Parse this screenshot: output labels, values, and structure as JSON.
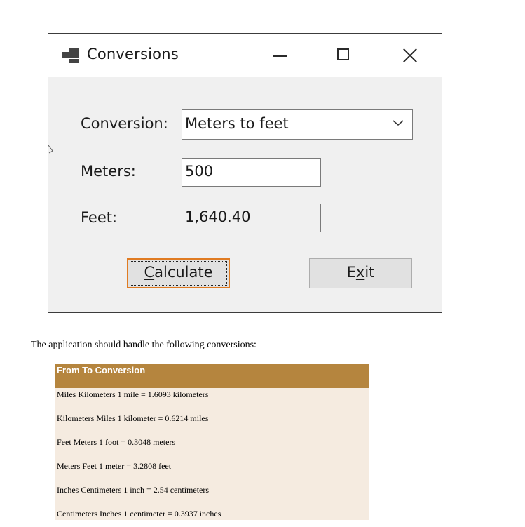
{
  "window": {
    "title": "Conversions",
    "app_icon": "app-window-icon",
    "controls": {
      "minimize_icon": "minimize-icon",
      "maximize_icon": "maximize-icon",
      "close_icon": "close-icon"
    }
  },
  "form": {
    "conversion_label": "Conversion:",
    "conversion_value": "Meters to feet",
    "conversion_arrow_icon": "chevron-down-icon",
    "meters_label": "Meters:",
    "meters_value": "500",
    "feet_label": "Feet:",
    "feet_value": "1,640.40",
    "calculate_prefix": "C",
    "calculate_rest": "alculate",
    "exit_prefix": "E",
    "exit_mnemonic": "x",
    "exit_suffix": "it"
  },
  "colors": {
    "focus_border": "#e07b22",
    "table_header_bg": "#b5853e",
    "table_row_bg": "#f5ebe0"
  },
  "document": {
    "intro": "The application should handle the following conversions:",
    "table": {
      "header": "From To Conversion",
      "rows": [
        "Miles Kilometers 1 mile = 1.6093 kilometers",
        "Kilometers Miles 1 kilometer = 0.6214 miles",
        "Feet Meters 1 foot = 0.3048 meters",
        "Meters Feet 1 meter = 3.2808 feet",
        "Inches Centimeters 1 inch = 2.54 centimeters",
        "Centimeters Inches 1 centimeter = 0.3937 inches"
      ]
    }
  }
}
